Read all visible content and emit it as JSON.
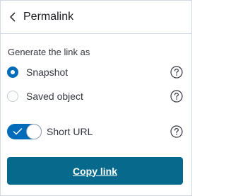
{
  "header": {
    "title": "Permalink",
    "back_icon": "chevron-left-icon"
  },
  "form": {
    "section_label": "Generate the link as",
    "options": [
      {
        "label": "Snapshot",
        "checked": true,
        "help_icon": "question-circle-icon"
      },
      {
        "label": "Saved object",
        "checked": false,
        "help_icon": "question-circle-icon"
      }
    ],
    "short_url": {
      "label": "Short URL",
      "enabled": true,
      "help_icon": "question-circle-icon"
    }
  },
  "actions": {
    "copy_label": "Copy link"
  },
  "colors": {
    "accent": "#006bb8",
    "button": "#07698c",
    "border": "#d3dae6",
    "text": "#343741"
  }
}
